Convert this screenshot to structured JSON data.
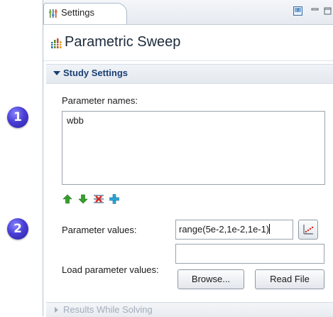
{
  "callouts": [
    "1",
    "2"
  ],
  "tab": {
    "label": "Settings",
    "icon": "settings-sliders-icon"
  },
  "window_controls": [
    "help-icon",
    "minimize-icon",
    "maximize-icon"
  ],
  "header": {
    "title": "Parametric Sweep",
    "icon": "parametric-sweep-icon"
  },
  "study_settings": {
    "label": "Study Settings",
    "parameter_names_label": "Parameter names:",
    "parameter_names": [
      "wbb"
    ],
    "toolbar": [
      "move-up-icon",
      "move-down-icon",
      "delete-icon",
      "add-icon"
    ],
    "parameter_values_label": "Parameter values:",
    "parameter_values": "range(5e-2,1e-2,1e-1)",
    "range_plot_icon": "range-plot-icon",
    "load_label": "Load parameter values:",
    "load_path": "",
    "browse_label": "Browse...",
    "read_file_label": "Read File"
  },
  "results_section": {
    "label": "Results While Solving"
  },
  "colors": {
    "accent": "#1a3f73",
    "badge": "#4a3fd6",
    "border": "#9aa3ad"
  }
}
